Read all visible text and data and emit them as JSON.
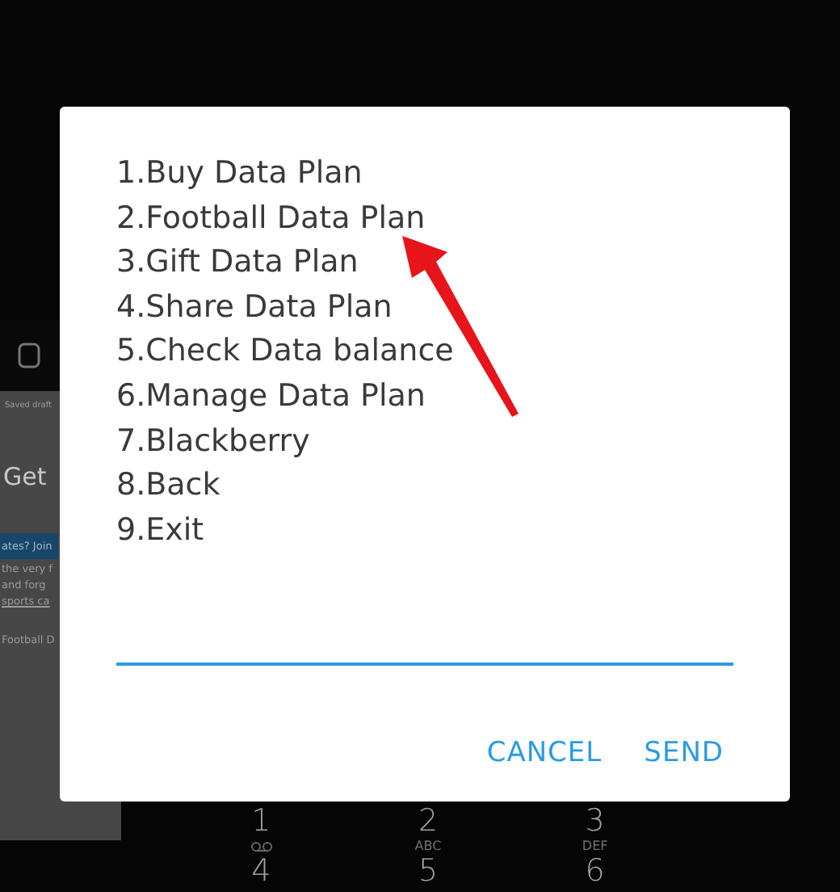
{
  "background_page": {
    "header_text": "Saved draft",
    "heading": "Get",
    "banner": "ates? Join",
    "paragraph_lines": [
      "the very f",
      "and forg",
      "sports ca"
    ],
    "footer_text": "Football D"
  },
  "dialer": {
    "keys": [
      {
        "digit": "1",
        "kind": "voicemail"
      },
      {
        "digit": "2",
        "letters": "ABC",
        "kind": "letters"
      },
      {
        "digit": "3",
        "letters": "DEF",
        "kind": "letters"
      },
      {
        "digit": "4",
        "kind": "plain"
      },
      {
        "digit": "5",
        "kind": "plain"
      },
      {
        "digit": "6",
        "kind": "plain"
      }
    ]
  },
  "dialog": {
    "menu_lines": [
      "1.Buy Data Plan",
      "2.Football Data Plan",
      "3.Gift Data Plan",
      "4.Share Data Plan",
      "5.Check Data balance",
      "6.Manage Data Plan",
      "7.Blackberry",
      "8.Back",
      "9.Exit"
    ],
    "buttons": [
      "CANCEL",
      "SEND"
    ]
  }
}
